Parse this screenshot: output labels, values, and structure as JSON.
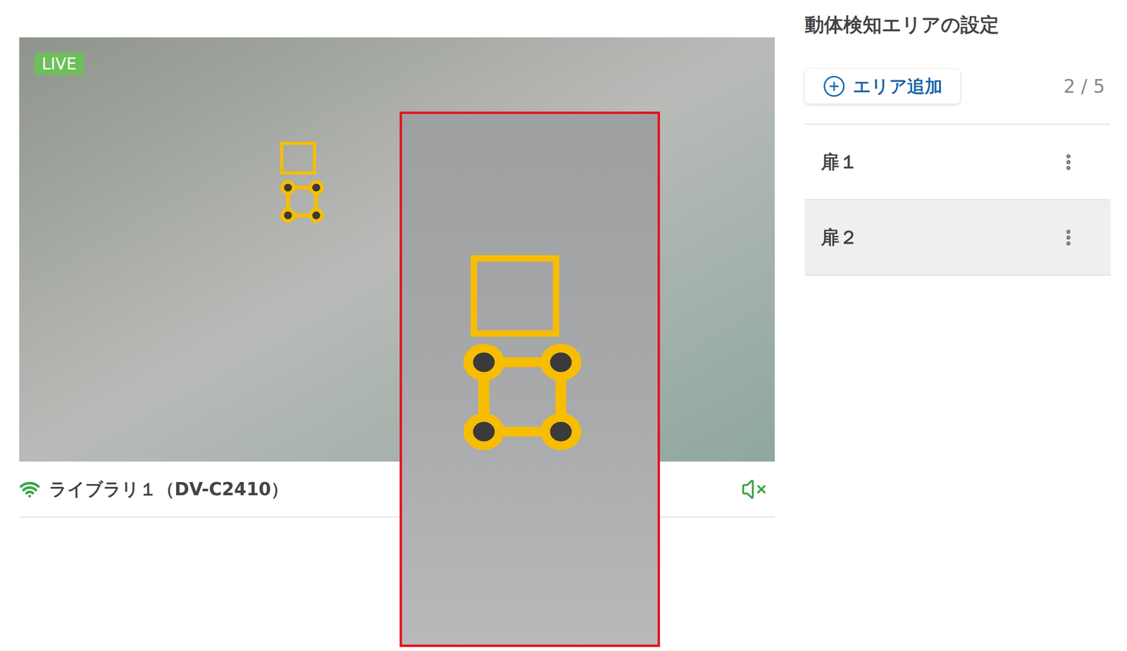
{
  "panel": {
    "title": "動体検知エリアの設定",
    "add_button": "エリア追加",
    "count": "2 / 5"
  },
  "areas": [
    {
      "label": "扉１",
      "selected": false
    },
    {
      "label": "扉２",
      "selected": true
    }
  ],
  "camera": {
    "badge": "LIVE",
    "name": "ライブラリ１（DV-C2410）",
    "connected": true,
    "muted": true
  }
}
